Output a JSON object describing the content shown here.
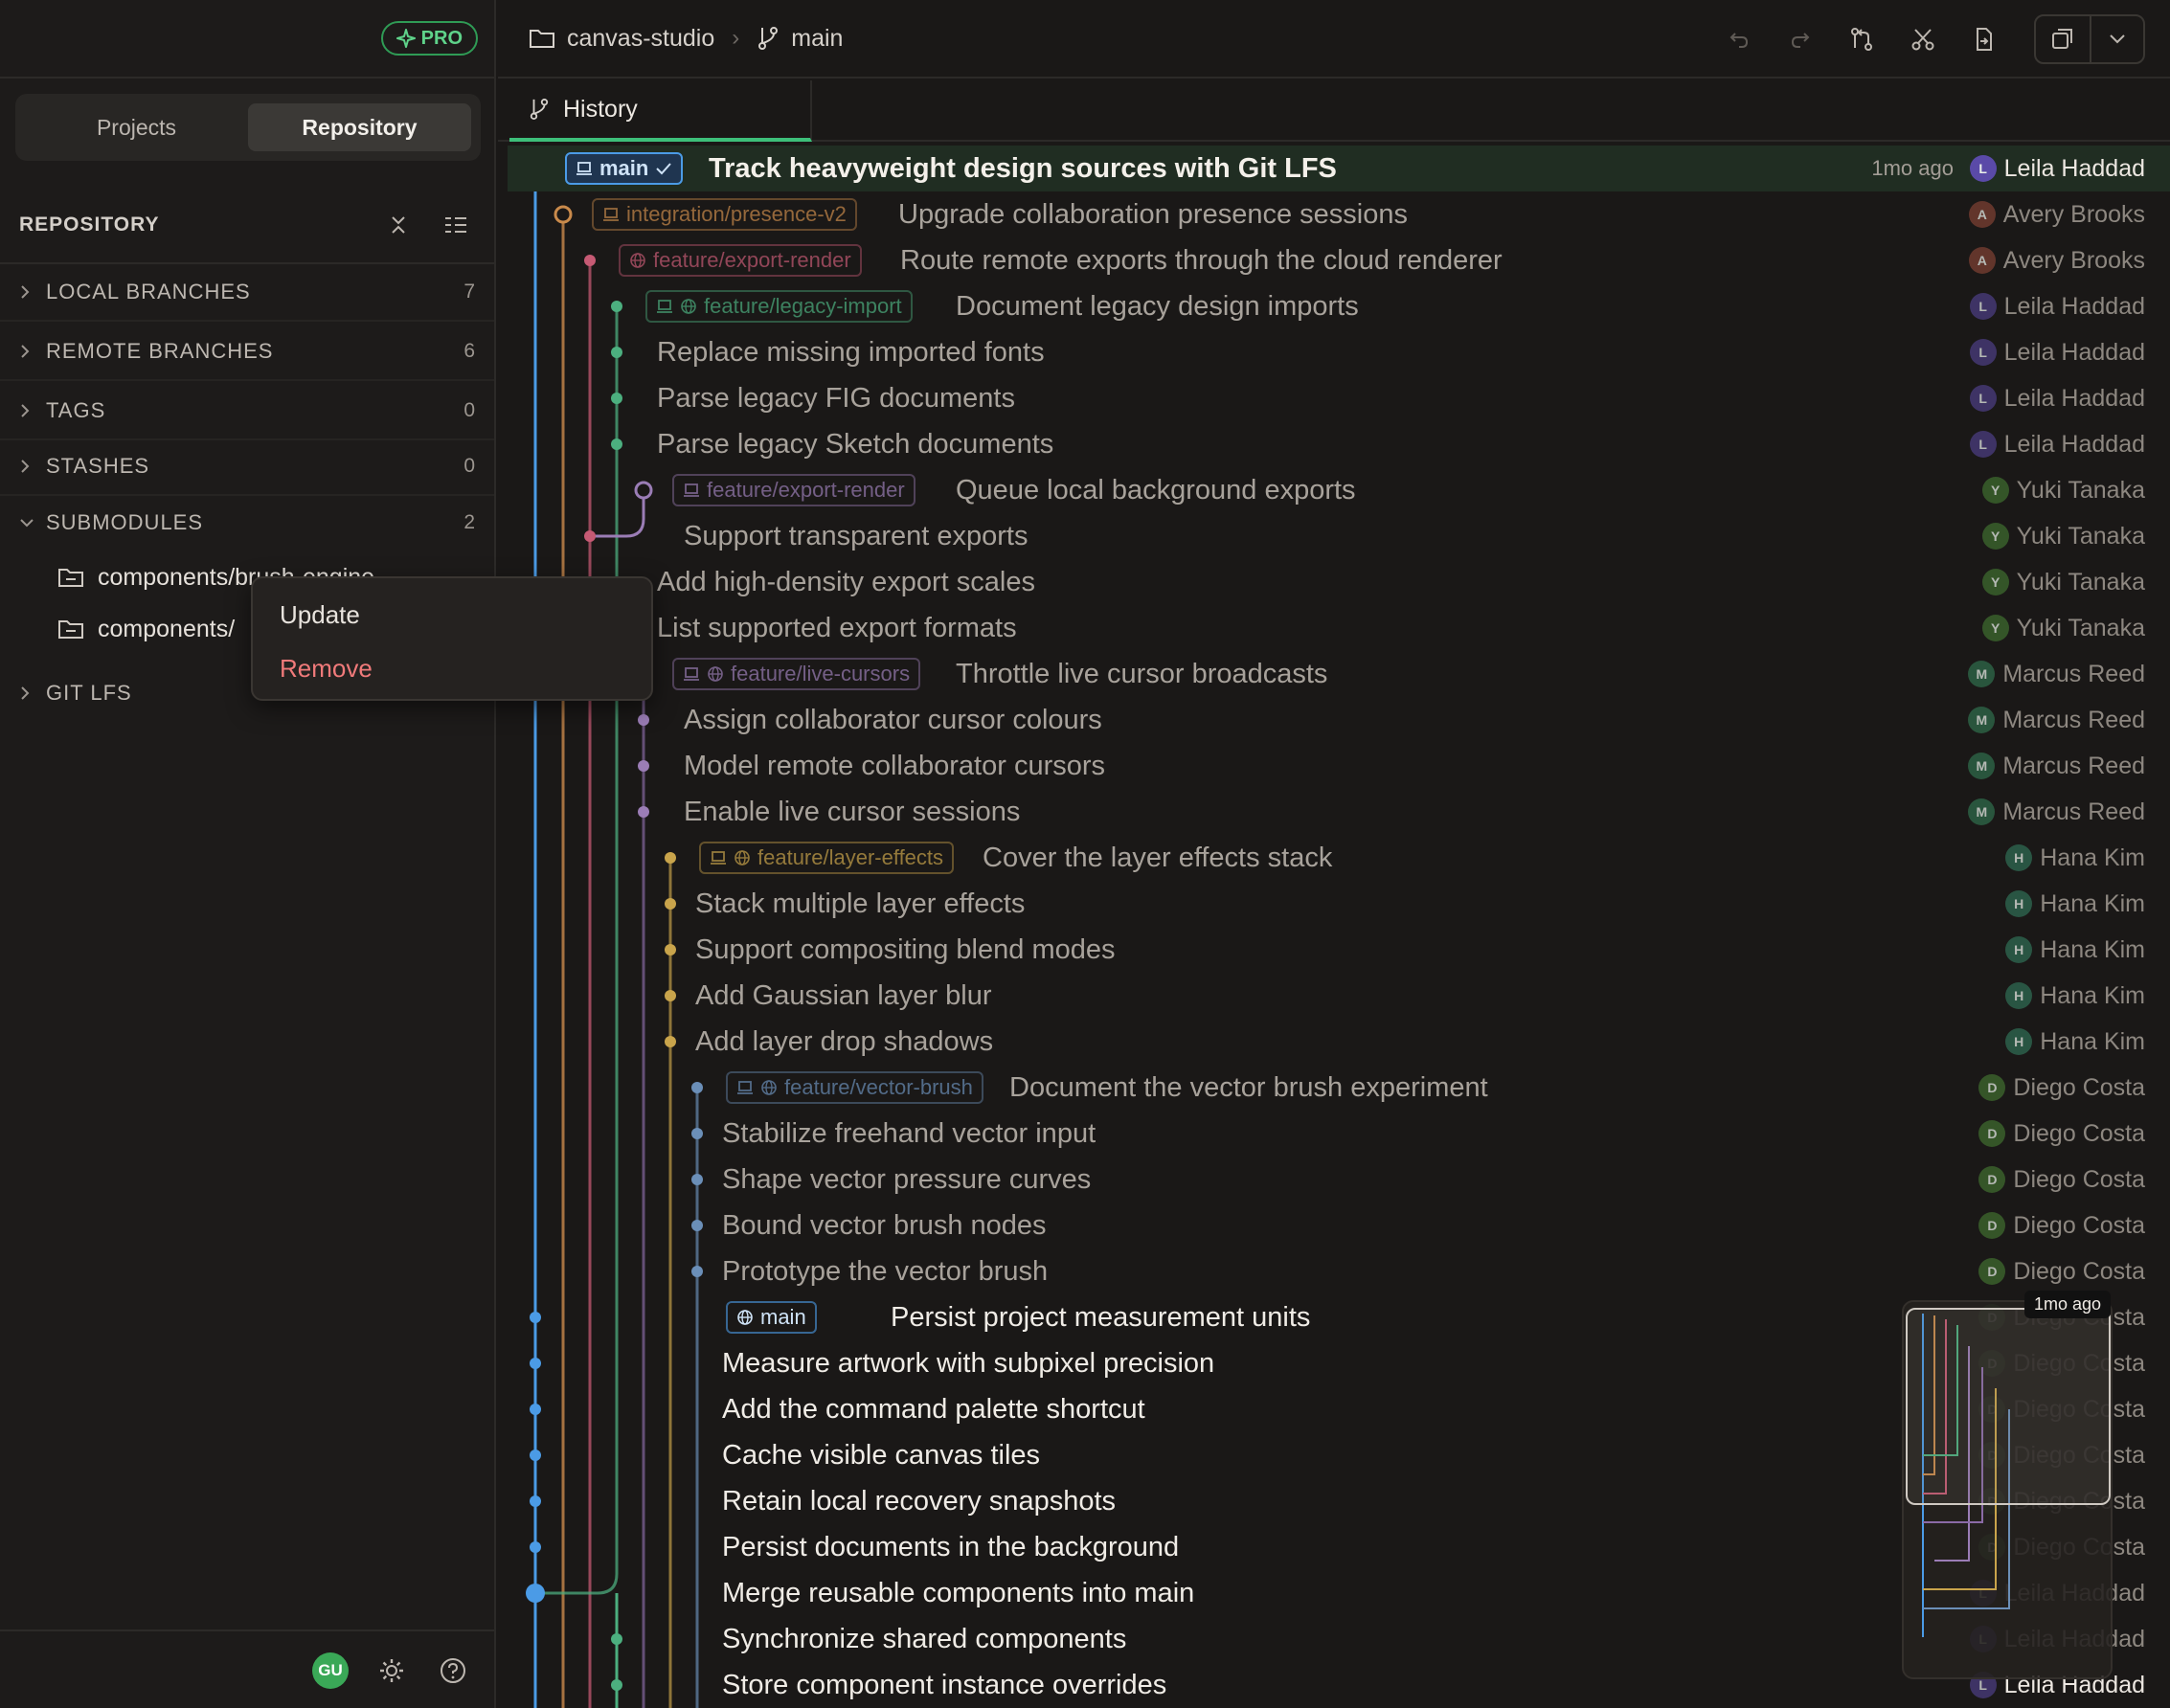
{
  "sidebar": {
    "pro_badge": "PRO",
    "tabs": [
      {
        "label": "Projects"
      },
      {
        "label": "Repository"
      }
    ],
    "repo_title": "REPOSITORY",
    "sections": [
      {
        "label": "LOCAL BRANCHES",
        "count": "7"
      },
      {
        "label": "REMOTE BRANCHES",
        "count": "6"
      },
      {
        "label": "TAGS",
        "count": "0"
      },
      {
        "label": "STASHES",
        "count": "0"
      },
      {
        "label": "SUBMODULES",
        "count": "2"
      },
      {
        "label": "GIT LFS",
        "count": ""
      }
    ],
    "submodules": [
      "components/brush-engine",
      "components/"
    ],
    "user_initials": "GU"
  },
  "context_menu": {
    "update": "Update",
    "remove": "Remove"
  },
  "topbar": {
    "repo": "canvas-studio",
    "branch": "main"
  },
  "tab": {
    "label": "History"
  },
  "colors": {
    "main": "#4b9be6",
    "integration": "#c98a4b",
    "export": "#c65a74",
    "legacy": "#4caf7f",
    "export2": "#9b7db6",
    "cursors": "#8a6aa6",
    "effects": "#c9a44b",
    "vector": "#6b8fb8"
  },
  "commits": [
    {
      "message": "Track heavyweight design sources with Git LFS",
      "badge": "main",
      "time": "1mo ago",
      "author": "Leila Haddad",
      "initial": "L"
    },
    {
      "message": "Upgrade collaboration presence sessions",
      "badge": "integration/presence-v2",
      "author": "Avery Brooks",
      "initial": "A"
    },
    {
      "message": "Route remote exports through the cloud renderer",
      "badge": "feature/export-render",
      "author": "Avery Brooks",
      "initial": "A"
    },
    {
      "message": "Document legacy design imports",
      "badge": "feature/legacy-import",
      "author": "Leila Haddad",
      "initial": "L"
    },
    {
      "message": "Replace missing imported fonts",
      "author": "Leila Haddad",
      "initial": "L"
    },
    {
      "message": "Parse legacy FIG documents",
      "author": "Leila Haddad",
      "initial": "L"
    },
    {
      "message": "Parse legacy Sketch documents",
      "author": "Leila Haddad",
      "initial": "L"
    },
    {
      "message": "Queue local background exports",
      "badge": "feature/export-render",
      "author": "Yuki Tanaka",
      "initial": "Y"
    },
    {
      "message": "Support transparent exports",
      "author": "Yuki Tanaka",
      "initial": "Y"
    },
    {
      "message": "Add high-density export scales",
      "author": "Yuki Tanaka",
      "initial": "Y"
    },
    {
      "message": "List supported export formats",
      "author": "Yuki Tanaka",
      "initial": "Y"
    },
    {
      "message": "Throttle live cursor broadcasts",
      "badge": "feature/live-cursors",
      "author": "Marcus Reed",
      "initial": "M"
    },
    {
      "message": "Assign collaborator cursor colours",
      "author": "Marcus Reed",
      "initial": "M"
    },
    {
      "message": "Model remote collaborator cursors",
      "author": "Marcus Reed",
      "initial": "M"
    },
    {
      "message": "Enable live cursor sessions",
      "author": "Marcus Reed",
      "initial": "M"
    },
    {
      "message": "Cover the layer effects stack",
      "badge": "feature/layer-effects",
      "author": "Hana Kim",
      "initial": "H"
    },
    {
      "message": "Stack multiple layer effects",
      "author": "Hana Kim",
      "initial": "H"
    },
    {
      "message": "Support compositing blend modes",
      "author": "Hana Kim",
      "initial": "H"
    },
    {
      "message": "Add Gaussian layer blur",
      "author": "Hana Kim",
      "initial": "H"
    },
    {
      "message": "Add layer drop shadows",
      "author": "Hana Kim",
      "initial": "H"
    },
    {
      "message": "Document the vector brush experiment",
      "badge": "feature/vector-brush",
      "author": "Diego Costa",
      "initial": "D"
    },
    {
      "message": "Stabilize freehand vector input",
      "author": "Diego Costa",
      "initial": "D"
    },
    {
      "message": "Shape vector pressure curves",
      "author": "Diego Costa",
      "initial": "D"
    },
    {
      "message": "Bound vector brush nodes",
      "author": "Diego Costa",
      "initial": "D"
    },
    {
      "message": "Prototype the vector brush",
      "author": "Diego Costa",
      "initial": "D"
    },
    {
      "message": "Persist project measurement units",
      "badge": "main",
      "author": "Diego Costa",
      "initial": "D"
    },
    {
      "message": "Measure artwork with subpixel precision",
      "author": "Diego Costa",
      "initial": "D"
    },
    {
      "message": "Add the command palette shortcut",
      "author": "Diego Costa",
      "initial": "D"
    },
    {
      "message": "Cache visible canvas tiles",
      "author": "Diego Costa",
      "initial": "D"
    },
    {
      "message": "Retain local recovery snapshots",
      "author": "Diego Costa",
      "initial": "D"
    },
    {
      "message": "Persist documents in the background",
      "author": "Diego Costa",
      "initial": "D"
    },
    {
      "message": "Merge reusable components into main",
      "author": "Leila Haddad",
      "initial": "L"
    },
    {
      "message": "Synchronize shared components",
      "author": "Leila Haddad",
      "initial": "L"
    },
    {
      "message": "Store component instance overrides",
      "author": "Leila Haddad",
      "initial": "L"
    }
  ],
  "minimap": {
    "tooltip": "1mo ago"
  }
}
